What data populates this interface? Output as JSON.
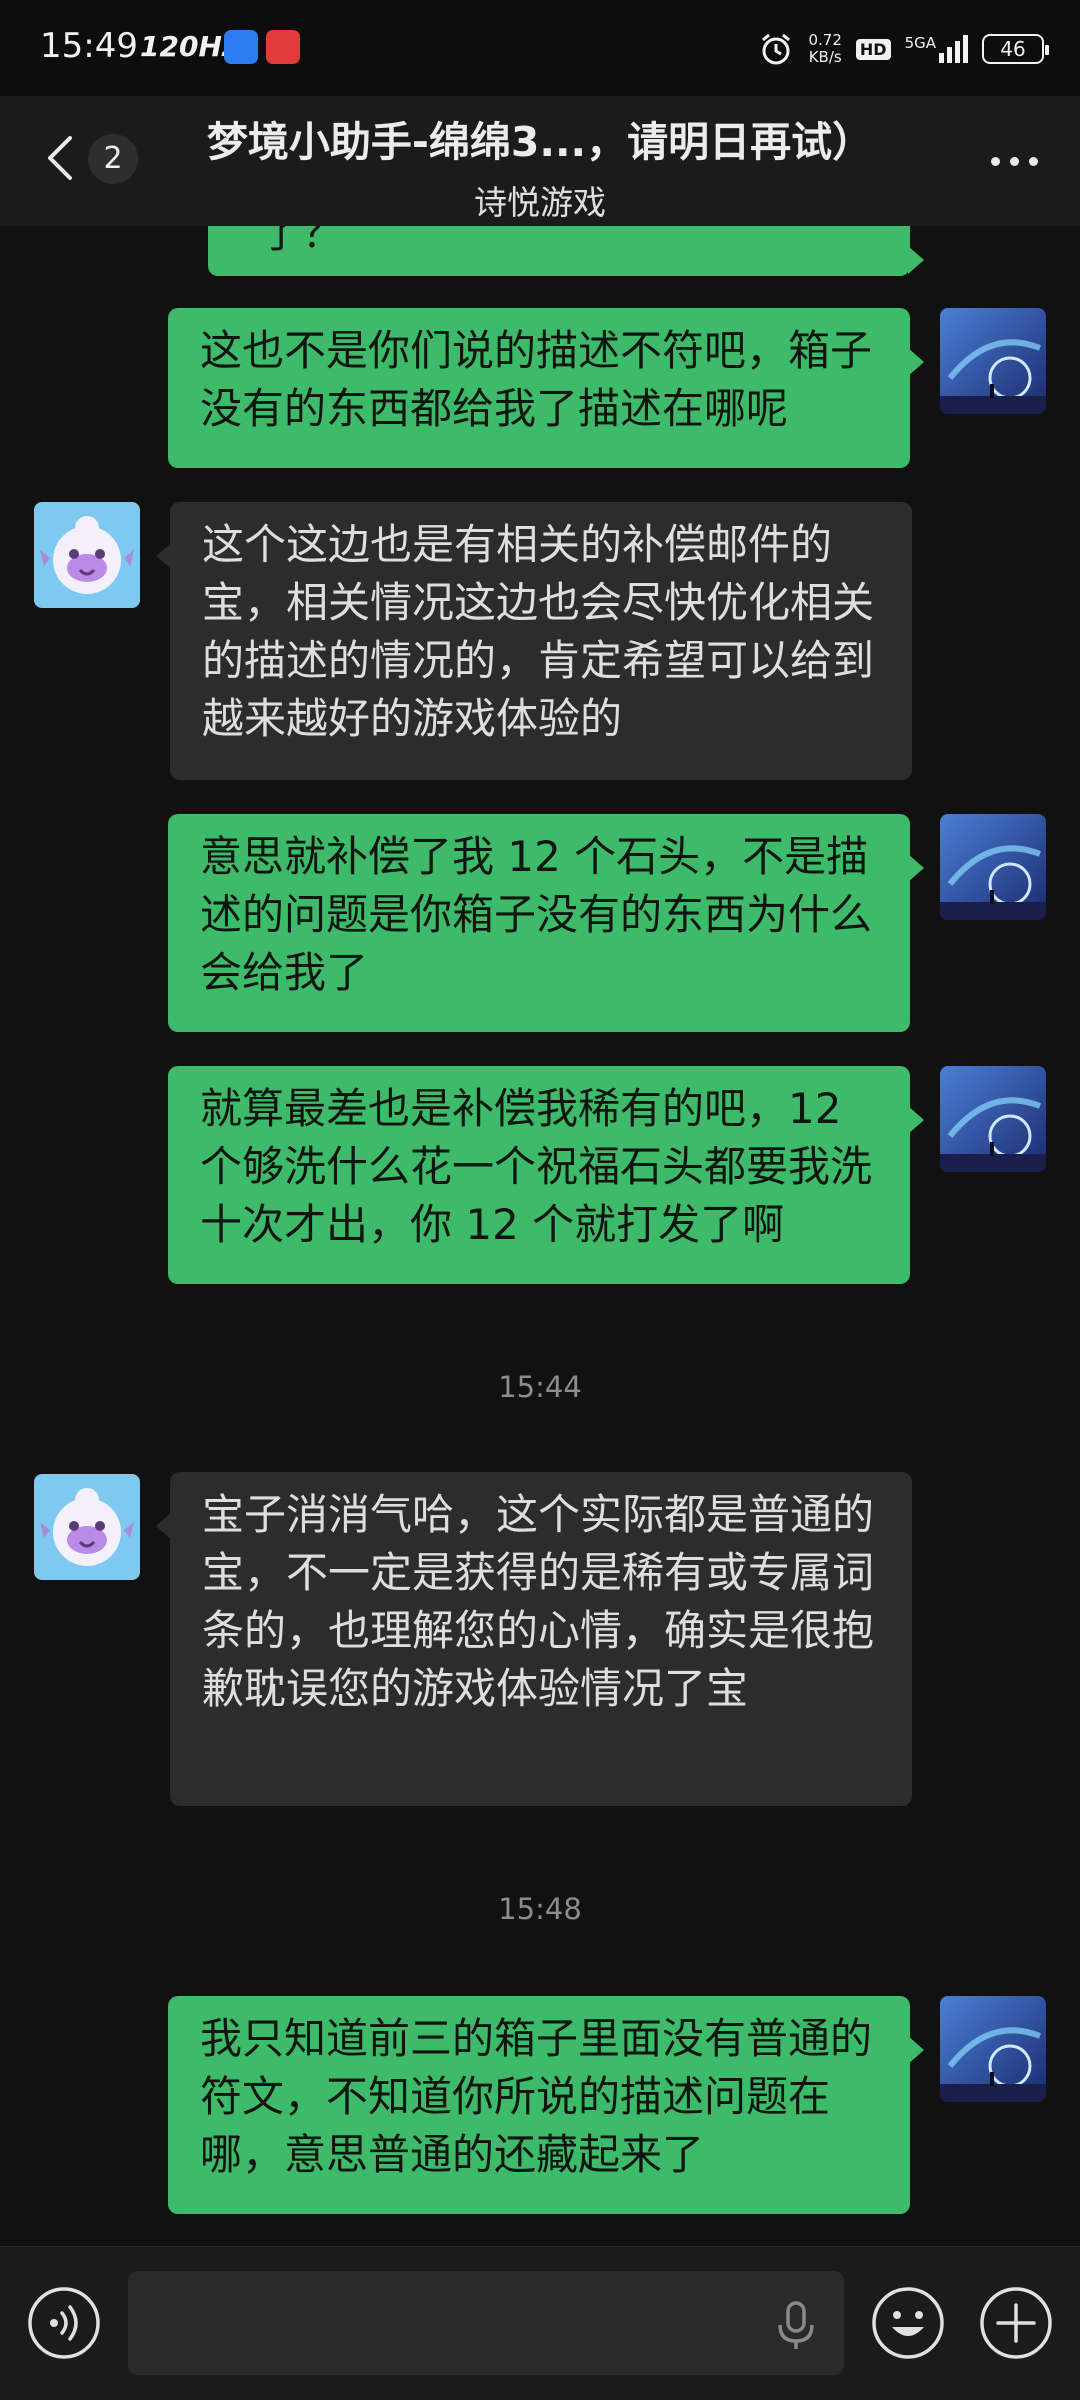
{
  "status": {
    "time": "15:49",
    "refresh": "120Hz",
    "net_speed": "0.72",
    "net_unit": "KB/s",
    "hd": "HD",
    "network": "5GA",
    "battery": "46"
  },
  "header": {
    "back_count": "2",
    "title": "梦境小助手-绵绵3...，请明日再试）",
    "subtitle": "诗悦游戏"
  },
  "messages": [
    {
      "from": "me",
      "text": "了？"
    },
    {
      "from": "me",
      "text": "这也不是你们说的描述不符吧，箱子没有的东西都给我了描述在哪呢"
    },
    {
      "from": "them",
      "text": "这个这边也是有相关的补偿邮件的宝，相关情况这边也会尽快优化相关的描述的情况的，肯定希望可以给到越来越好的游戏体验的"
    },
    {
      "from": "me",
      "text": "意思就补偿了我 12 个石头，不是描述的问题是你箱子没有的东西为什么会给我了"
    },
    {
      "from": "me",
      "text": "就算最差也是补偿我稀有的吧，12 个够洗什么花一个祝福石头都要我洗十次才出，你 12 个就打发了啊"
    },
    {
      "type": "time",
      "text": "15:44"
    },
    {
      "from": "them",
      "text": "宝子消消气哈，这个实际都是普通的宝，不一定是获得的是稀有或专属词条的，也理解您的心情，确实是很抱歉耽误您的游戏体验情况了宝"
    },
    {
      "type": "time",
      "text": "15:48"
    },
    {
      "from": "me",
      "text": "我只知道前三的箱子里面没有普通的符文，不知道你所说的描述问题在哪，意思普通的还藏起来了"
    }
  ],
  "input": {
    "placeholder": ""
  },
  "colors": {
    "my_bubble": "#3dbb6b",
    "their_bubble": "#2c2c2c",
    "background": "#111111"
  }
}
